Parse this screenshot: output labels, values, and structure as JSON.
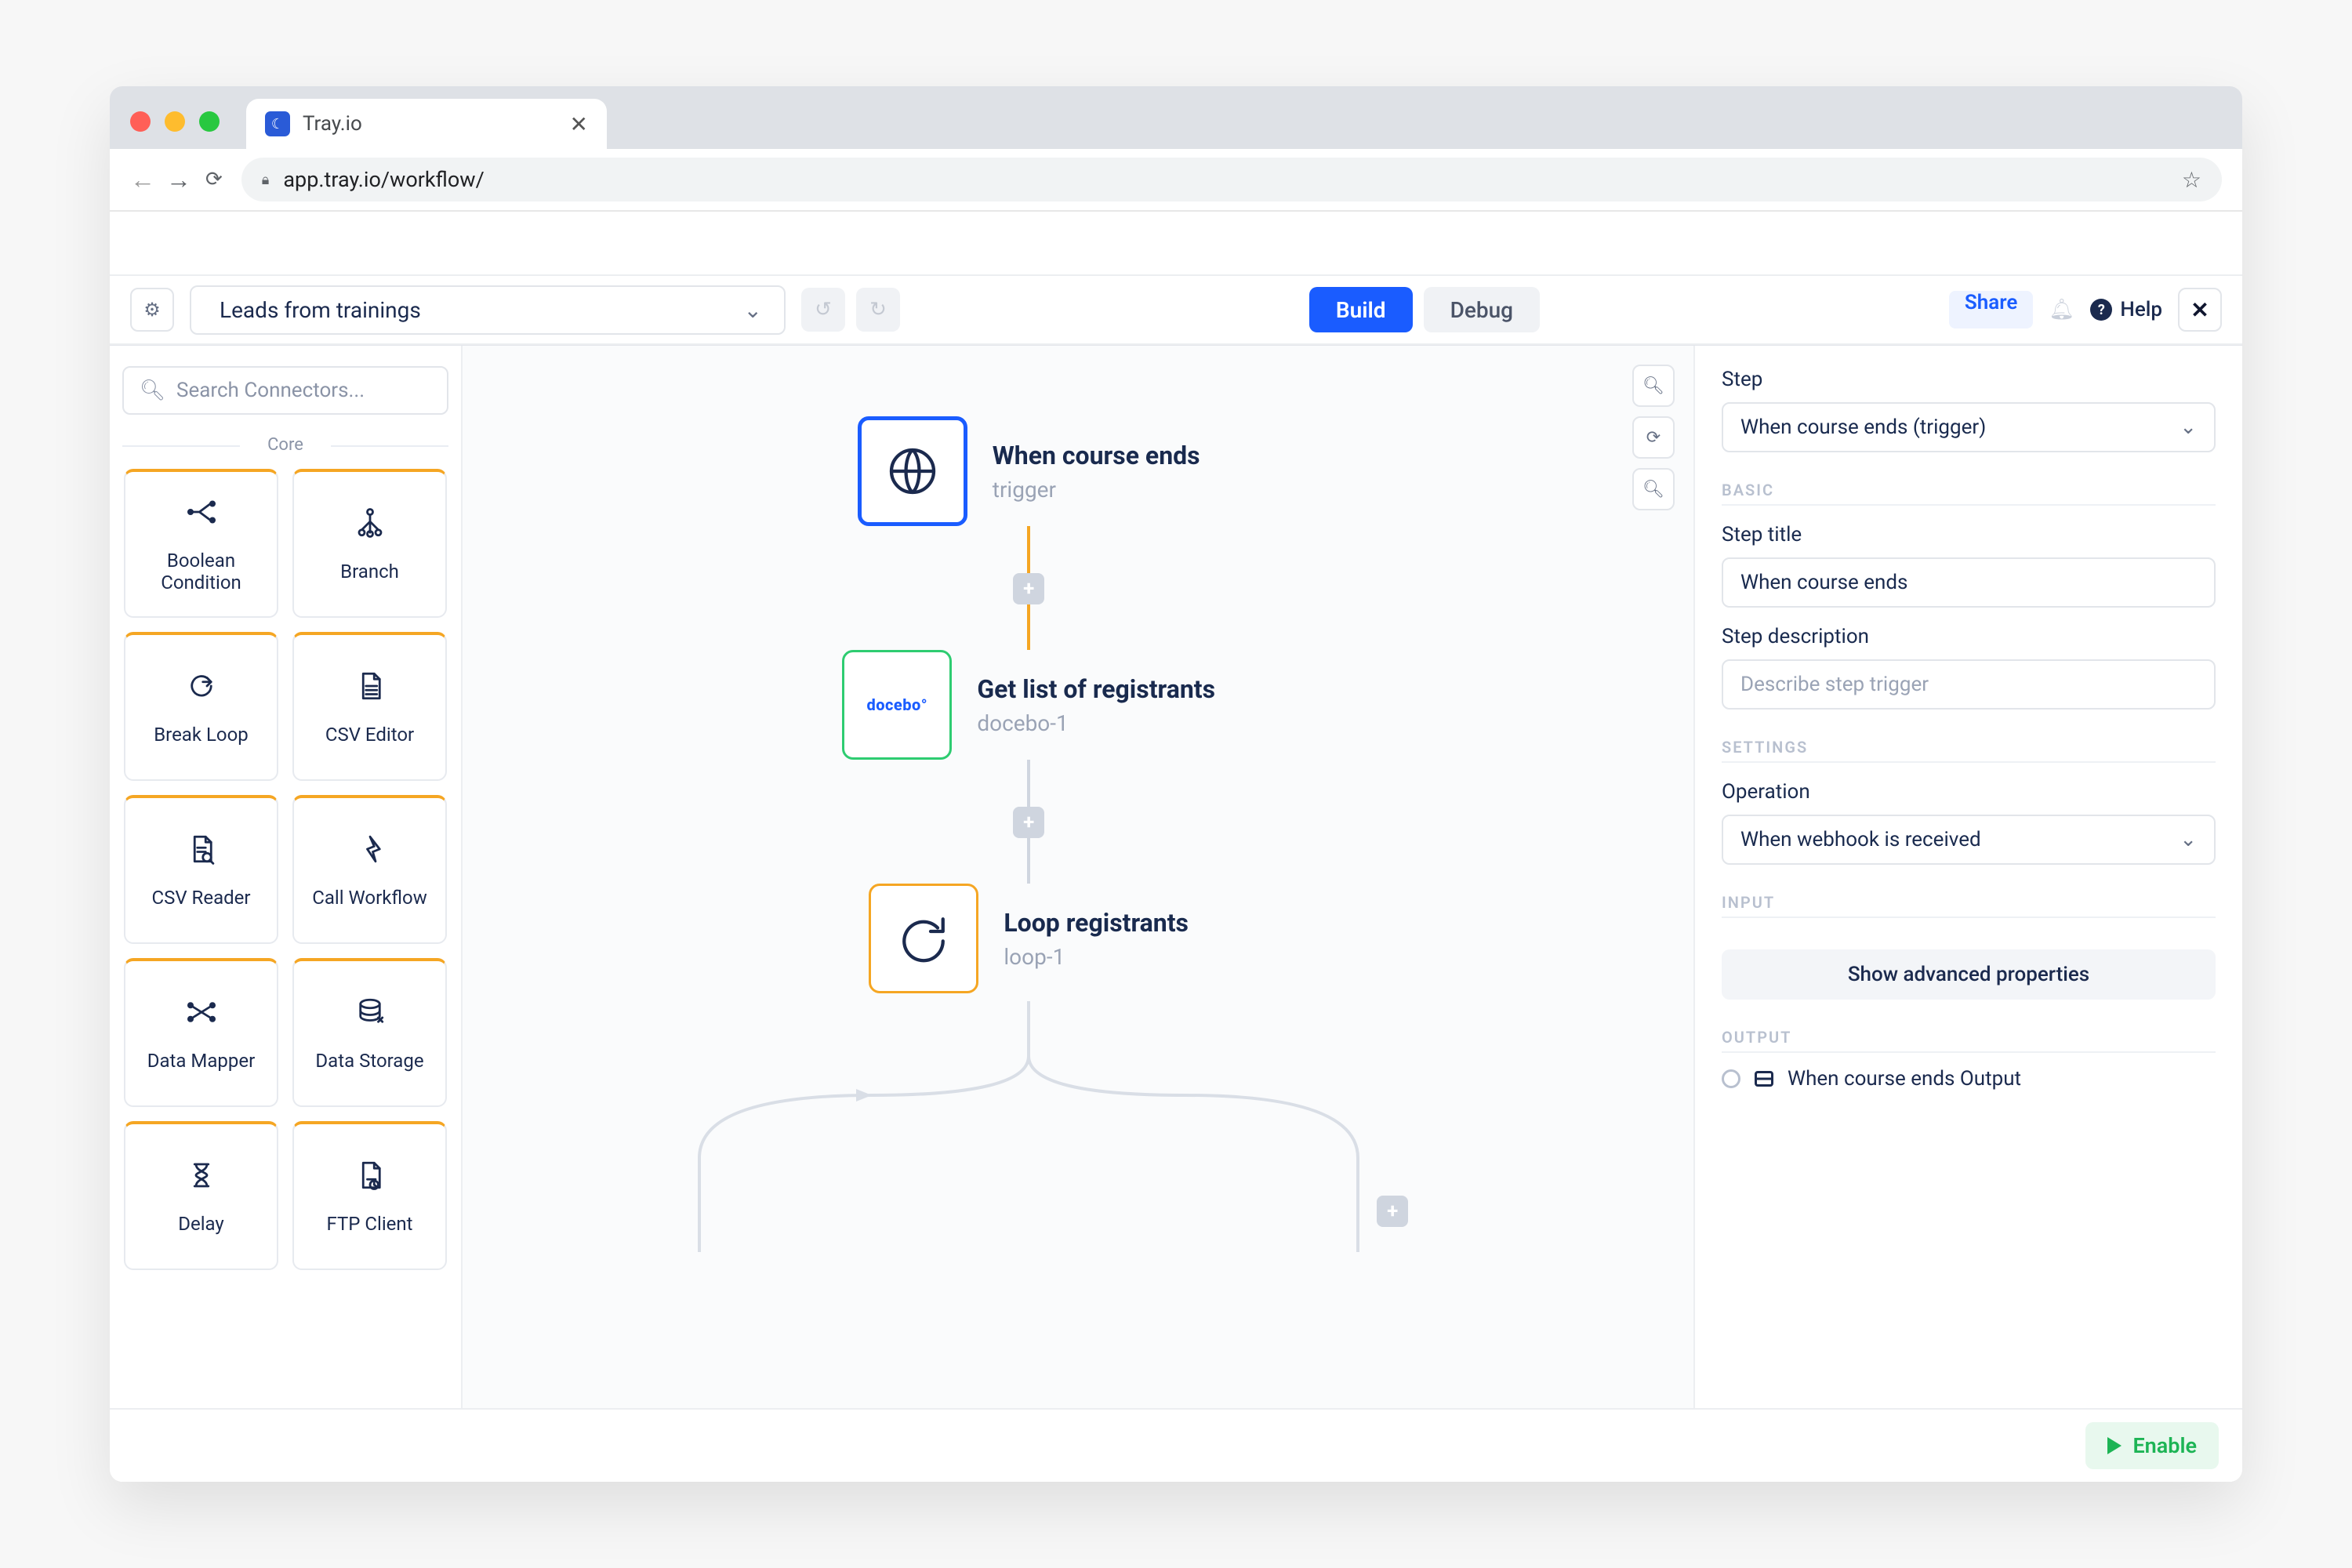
{
  "browser": {
    "tab_title": "Tray.io",
    "url": "app.tray.io/workflow/"
  },
  "topbar": {
    "workflow_name": "Leads from trainings",
    "build_label": "Build",
    "debug_label": "Debug",
    "share_label": "Share",
    "help_label": "Help"
  },
  "sidebar": {
    "search_placeholder": "Search Connectors...",
    "core_label": "Core",
    "tiles": [
      {
        "label": "Boolean Condition",
        "icon": "boolean-condition-icon"
      },
      {
        "label": "Branch",
        "icon": "branch-icon"
      },
      {
        "label": "Break Loop",
        "icon": "break-loop-icon"
      },
      {
        "label": "CSV Editor",
        "icon": "csv-editor-icon"
      },
      {
        "label": "CSV Reader",
        "icon": "csv-reader-icon"
      },
      {
        "label": "Call Workflow",
        "icon": "call-workflow-icon"
      },
      {
        "label": "Data Mapper",
        "icon": "data-mapper-icon"
      },
      {
        "label": "Data Storage",
        "icon": "data-storage-icon"
      },
      {
        "label": "Delay",
        "icon": "delay-icon"
      },
      {
        "label": "FTP Client",
        "icon": "ftp-client-icon"
      }
    ]
  },
  "canvas": {
    "nodes": [
      {
        "title": "When course ends",
        "subtitle": "trigger",
        "kind": "selected",
        "icon": "globe-icon"
      },
      {
        "title": "Get list of registrants",
        "subtitle": "docebo-1",
        "kind": "green",
        "icon": "docebo-logo"
      },
      {
        "title": "Loop registrants",
        "subtitle": "loop-1",
        "kind": "orange",
        "icon": "loop-icon"
      }
    ]
  },
  "props": {
    "step_label": "Step",
    "step_value": "When course ends (trigger)",
    "basic_label": "BASIC",
    "title_label": "Step title",
    "title_value": "When course ends",
    "desc_label": "Step description",
    "desc_placeholder": "Describe step trigger",
    "settings_label": "SETTINGS",
    "operation_label": "Operation",
    "operation_value": "When webhook is received",
    "input_label": "INPUT",
    "advanced_label": "Show advanced properties",
    "output_label": "OUTPUT",
    "output_item": "When course ends Output"
  },
  "footer": {
    "enable_label": "Enable"
  }
}
